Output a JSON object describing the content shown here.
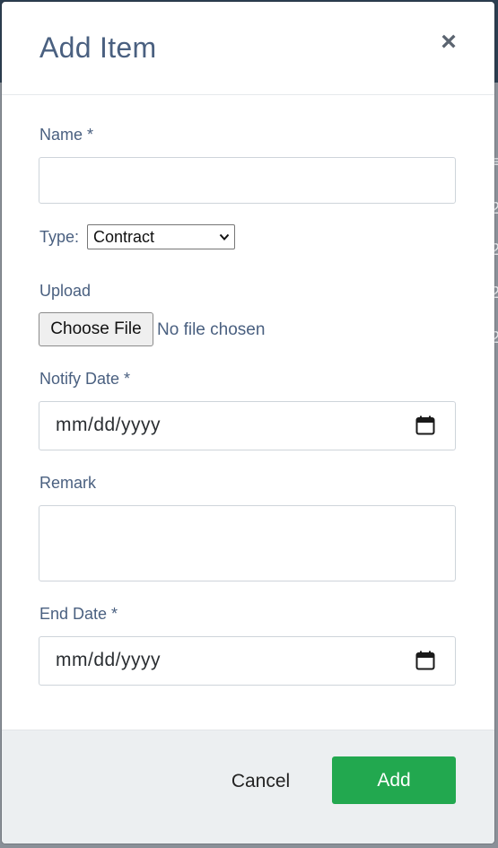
{
  "modal": {
    "title": "Add Item",
    "close_glyph": "×"
  },
  "form": {
    "name_label": "Name *",
    "name_value": "",
    "type_label": "Type:",
    "type_selected": "Contract",
    "upload_label": "Upload",
    "choose_file_label": "Choose File",
    "file_status": "No file chosen",
    "notify_date_label": "Notify Date *",
    "notify_date_placeholder": "mm/dd/yyyy",
    "remark_label": "Remark",
    "remark_value": "",
    "end_date_label": "End Date *",
    "end_date_placeholder": "mm/dd/yyyy"
  },
  "footer": {
    "cancel_label": "Cancel",
    "add_label": "Add"
  },
  "colors": {
    "accent_green": "#22a84f",
    "label_blue": "#4a6080",
    "footer_bg": "#eceff1"
  },
  "icons": {
    "close": "close-icon",
    "calendar": "calendar-icon",
    "select": "chevron-down-icon"
  }
}
